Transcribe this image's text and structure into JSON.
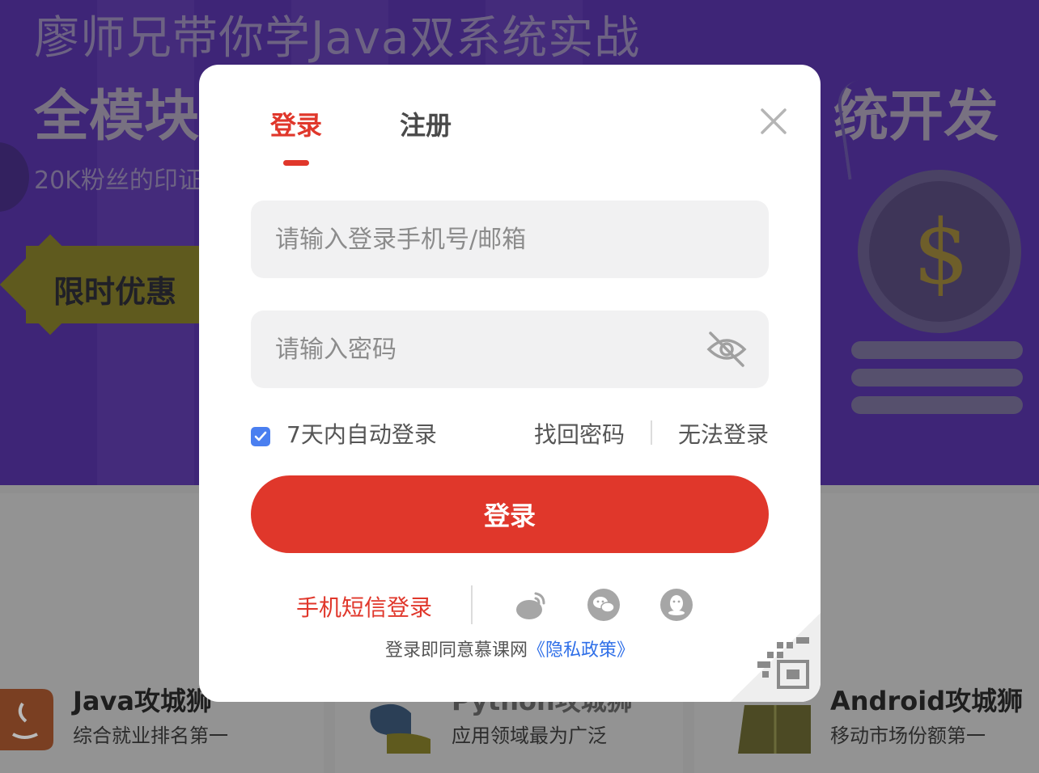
{
  "background": {
    "banner_title": "廖师兄带你学Java双系统实战",
    "banner_big_left": "全模块",
    "banner_big_right": "统开发",
    "banner_sub": "20K粉丝的印证",
    "promo": "限时优惠",
    "courses": [
      {
        "name": "Java攻城狮",
        "desc": "综合就业排名第一"
      },
      {
        "name": "Python攻城狮",
        "desc": "应用领域最为广泛"
      },
      {
        "name": "Android攻城狮",
        "desc": "移动市场份额第一"
      }
    ]
  },
  "modal": {
    "tabs": {
      "login": "登录",
      "register": "注册"
    },
    "phone_placeholder": "请输入登录手机号/邮箱",
    "password_placeholder": "请输入密码",
    "remember_label": "7天内自动登录",
    "remember_checked": true,
    "find_password": "找回密码",
    "cant_login": "无法登录",
    "login_button": "登录",
    "sms_login": "手机短信登录",
    "social_icons": [
      "weibo-icon",
      "wechat-icon",
      "qq-icon"
    ],
    "policy_prefix": "登录即同意慕课网",
    "policy_link": "《隐私政策》"
  },
  "colors": {
    "accent": "#e0372b",
    "link_blue": "#2f6fe8",
    "checkbox_blue": "#4a7ff0"
  }
}
